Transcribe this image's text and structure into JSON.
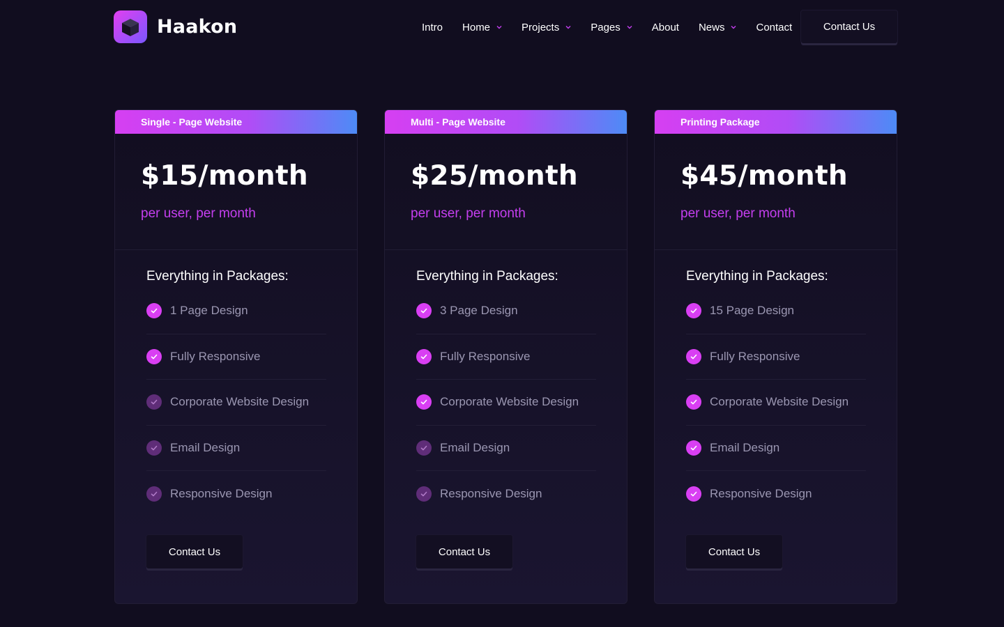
{
  "brand": {
    "name": "Haakon",
    "logo_icon": "cube-icon",
    "accent_pink": "#d93ff3",
    "accent_blue": "#4d8bf6",
    "background": "#110d1f"
  },
  "nav": {
    "items": [
      {
        "label": "Intro",
        "dropdown": false
      },
      {
        "label": "Home",
        "dropdown": true
      },
      {
        "label": "Projects",
        "dropdown": true
      },
      {
        "label": "Pages",
        "dropdown": true
      },
      {
        "label": "About",
        "dropdown": false
      },
      {
        "label": "News",
        "dropdown": true
      },
      {
        "label": "Contact",
        "dropdown": false
      }
    ],
    "cta_label": "Contact Us"
  },
  "plans": [
    {
      "tag": "Single - Page Website",
      "price": "$15/month",
      "note": "per user, per month",
      "features_title": "Everything in Packages:",
      "features": [
        {
          "label": "1 Page Design",
          "included": true
        },
        {
          "label": "Fully Responsive",
          "included": true
        },
        {
          "label": "Corporate Website Design",
          "included": false
        },
        {
          "label": "Email Design",
          "included": false
        },
        {
          "label": "Responsive Design",
          "included": false
        }
      ],
      "button_label": "Contact Us"
    },
    {
      "tag": "Multi - Page Website",
      "price": "$25/month",
      "note": "per user, per month",
      "features_title": "Everything in Packages:",
      "features": [
        {
          "label": "3 Page Design",
          "included": true
        },
        {
          "label": "Fully Responsive",
          "included": true
        },
        {
          "label": "Corporate Website Design",
          "included": true
        },
        {
          "label": "Email Design",
          "included": false
        },
        {
          "label": "Responsive Design",
          "included": false
        }
      ],
      "button_label": "Contact Us"
    },
    {
      "tag": "Printing Package",
      "price": "$45/month",
      "note": "per user, per month",
      "features_title": "Everything in Packages:",
      "features": [
        {
          "label": "15 Page Design",
          "included": true
        },
        {
          "label": "Fully Responsive",
          "included": true
        },
        {
          "label": "Corporate Website Design",
          "included": true
        },
        {
          "label": "Email Design",
          "included": true
        },
        {
          "label": "Responsive Design",
          "included": true
        }
      ],
      "button_label": "Contact Us"
    }
  ]
}
